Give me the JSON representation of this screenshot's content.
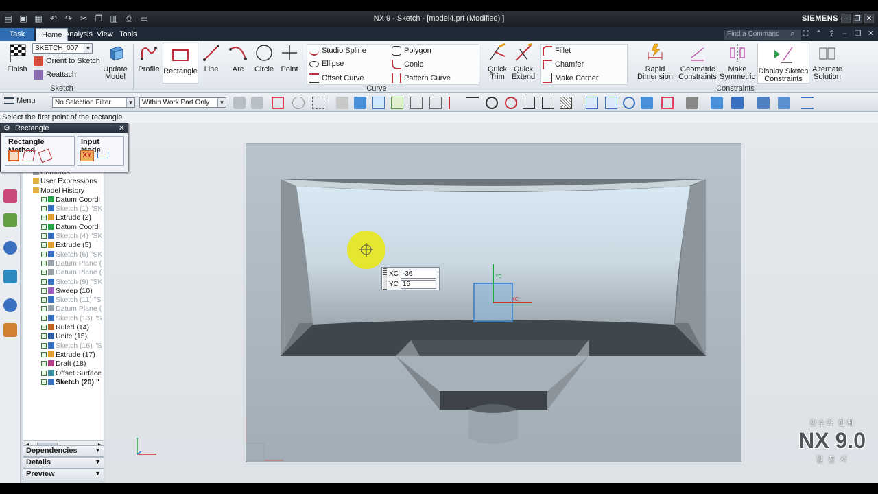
{
  "window": {
    "title": "NX 9 - Sketch - [model4.prt (Modified) ]",
    "brand": "SIEMENS"
  },
  "menu_tabs": [
    "Task",
    "Home",
    "Analysis",
    "View",
    "Tools"
  ],
  "find_command_placeholder": "Find a Command",
  "ribbon": {
    "finish_label": "Finish",
    "sketch_name": "SKETCH_007",
    "orient_label": "Orient to Sketch",
    "reattach_label": "Reattach",
    "update_model_label": "Update Model",
    "sketch_group": "Sketch",
    "profile_label": "Profile",
    "rectangle_label": "Rectangle",
    "line_label": "Line",
    "arc_label": "Arc",
    "circle_label": "Circle",
    "point_label": "Point",
    "studio_spline": "Studio Spline",
    "polygon": "Polygon",
    "ellipse": "Ellipse",
    "conic": "Conic",
    "offset_curve": "Offset Curve",
    "pattern_curve": "Pattern Curve",
    "curve_group": "Curve",
    "quick_trim": "Quick Trim",
    "quick_extend": "Quick Extend",
    "fillet": "Fillet",
    "chamfer": "Chamfer",
    "make_corner": "Make Corner",
    "rapid_dimension": "Rapid Dimension",
    "geometric_constraints": "Geometric Constraints",
    "make_symmetric": "Make Symmetric",
    "display_sketch_constraints": "Display Sketch Constraints",
    "alternate_solution": "Alternate Solution",
    "constraints_group": "Constraints"
  },
  "toolbar2": {
    "menu_label": "Menu",
    "selection_filter": "No Selection Filter",
    "scope": "Within Work Part Only"
  },
  "status_text": "Select the first point of the rectangle",
  "rectangle_dialog": {
    "title": "Rectangle",
    "method_label": "Rectangle Method",
    "input_mode_label": "Input Mode",
    "xy_label": "XY"
  },
  "navigator": {
    "rows": [
      {
        "label": "Cameras",
        "style": "normal",
        "kind": "camera"
      },
      {
        "label": "User Expressions",
        "style": "normal",
        "kind": "folder"
      },
      {
        "label": "Model History",
        "style": "normal",
        "kind": "folder"
      },
      {
        "label": "Datum Coordi",
        "style": "normal",
        "kind": "datum"
      },
      {
        "label": "Sketch (1) \"SK",
        "style": "gray",
        "kind": "sketch"
      },
      {
        "label": "Extrude (2)",
        "style": "normal",
        "kind": "extrude"
      },
      {
        "label": "Datum Coordi",
        "style": "normal",
        "kind": "datum"
      },
      {
        "label": "Sketch (4) \"SK",
        "style": "gray",
        "kind": "sketch"
      },
      {
        "label": "Extrude (5)",
        "style": "normal",
        "kind": "extrude"
      },
      {
        "label": "Sketch (6) \"SK",
        "style": "gray",
        "kind": "sketch"
      },
      {
        "label": "Datum Plane (",
        "style": "gray",
        "kind": "plane"
      },
      {
        "label": "Datum Plane (",
        "style": "gray",
        "kind": "plane"
      },
      {
        "label": "Sketch (9) \"SK",
        "style": "gray",
        "kind": "sketch"
      },
      {
        "label": "Sweep (10)",
        "style": "normal",
        "kind": "sweep"
      },
      {
        "label": "Sketch (11) \"S",
        "style": "gray",
        "kind": "sketch"
      },
      {
        "label": "Datum Plane (",
        "style": "gray",
        "kind": "plane"
      },
      {
        "label": "Sketch (13) \"S",
        "style": "gray",
        "kind": "sketch"
      },
      {
        "label": "Ruled (14)",
        "style": "normal",
        "kind": "ruled"
      },
      {
        "label": "Unite (15)",
        "style": "normal",
        "kind": "unite"
      },
      {
        "label": "Sketch (16) \"S",
        "style": "gray",
        "kind": "sketch"
      },
      {
        "label": "Extrude (17)",
        "style": "normal",
        "kind": "extrude"
      },
      {
        "label": "Draft (18)",
        "style": "normal",
        "kind": "draft"
      },
      {
        "label": "Offset Surface",
        "style": "normal",
        "kind": "offset"
      },
      {
        "label": "Sketch (20) \"",
        "style": "bold",
        "kind": "sketch"
      }
    ]
  },
  "panels": [
    "Dependencies",
    "Details",
    "Preview"
  ],
  "coords": {
    "xc_label": "XC",
    "xc_value": "-36",
    "yc_label": "YC",
    "yc_value": "15"
  },
  "csys_labels": {
    "yc": "YC",
    "xc": "XC"
  },
  "watermark": {
    "line1": "광수와 함께",
    "big": "NX 9.0",
    "line2": "알 찬 사"
  },
  "colors": {
    "accent": "#2f6db3",
    "highlight": "#e8e81a",
    "selected_tab": "#eef2f6"
  }
}
